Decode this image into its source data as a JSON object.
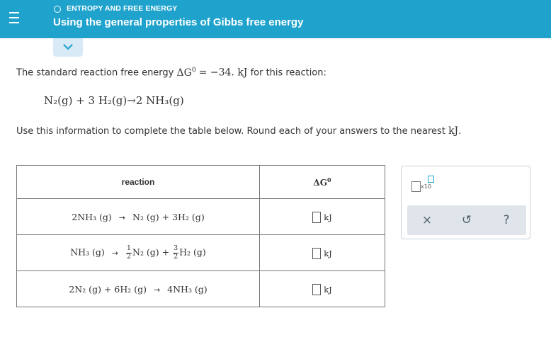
{
  "header": {
    "topic": "ENTROPY AND FREE ENERGY",
    "title": "Using the general properties of Gibbs free energy"
  },
  "problem": {
    "intro_prefix": "The standard reaction free energy",
    "dg_symbol": "ΔG",
    "dg_superscript": "0",
    "dg_value": "= −34. kJ",
    "intro_suffix": "for this reaction:",
    "reaction": "N₂(g) + 3 H₂(g)→2 NH₃(g)",
    "instructions_prefix": "Use this information to complete the table below. Round each of your answers to the nearest",
    "instructions_unit": "kJ",
    "instructions_end": "."
  },
  "table": {
    "col_reaction": "reaction",
    "col_dg": "ΔG",
    "col_dg_sup": "0",
    "arrow": "→",
    "rows": [
      {
        "left": "2NH₃ (g)",
        "right": "N₂ (g) + 3H₂ (g)",
        "unit": "kJ"
      },
      {
        "left": "NH₃ (g)",
        "frac1_num": "1",
        "frac1_den": "2",
        "term1": "N₂ (g) +",
        "frac2_num": "3",
        "frac2_den": "2",
        "term2": "H₂ (g)",
        "unit": "kJ"
      },
      {
        "left": "2N₂ (g) + 6H₂ (g)",
        "right": "4NH₃ (g)",
        "unit": "kJ"
      }
    ]
  },
  "tools": {
    "x10_label": "x10",
    "clear_icon": "×",
    "undo_icon": "↺",
    "help_icon": "?"
  }
}
